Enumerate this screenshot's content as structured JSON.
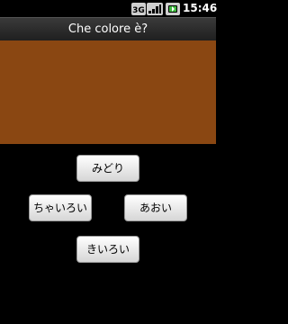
{
  "status_bar": {
    "network_label": "3G",
    "time": "15:46",
    "icons": [
      "3g-icon",
      "signal-icon",
      "battery-icon"
    ]
  },
  "title_bar": {
    "title": "Che colore è?"
  },
  "swatch": {
    "color": "#8a4712"
  },
  "answers": [
    {
      "label": "みどり"
    },
    {
      "label": "ちゃいろい"
    },
    {
      "label": "あおい"
    },
    {
      "label": "きいろい"
    }
  ],
  "colors": {
    "background": "#000000",
    "button_top": "#ffffff",
    "button_bottom": "#d6d6d6",
    "battery_green": "#3fb83f"
  }
}
